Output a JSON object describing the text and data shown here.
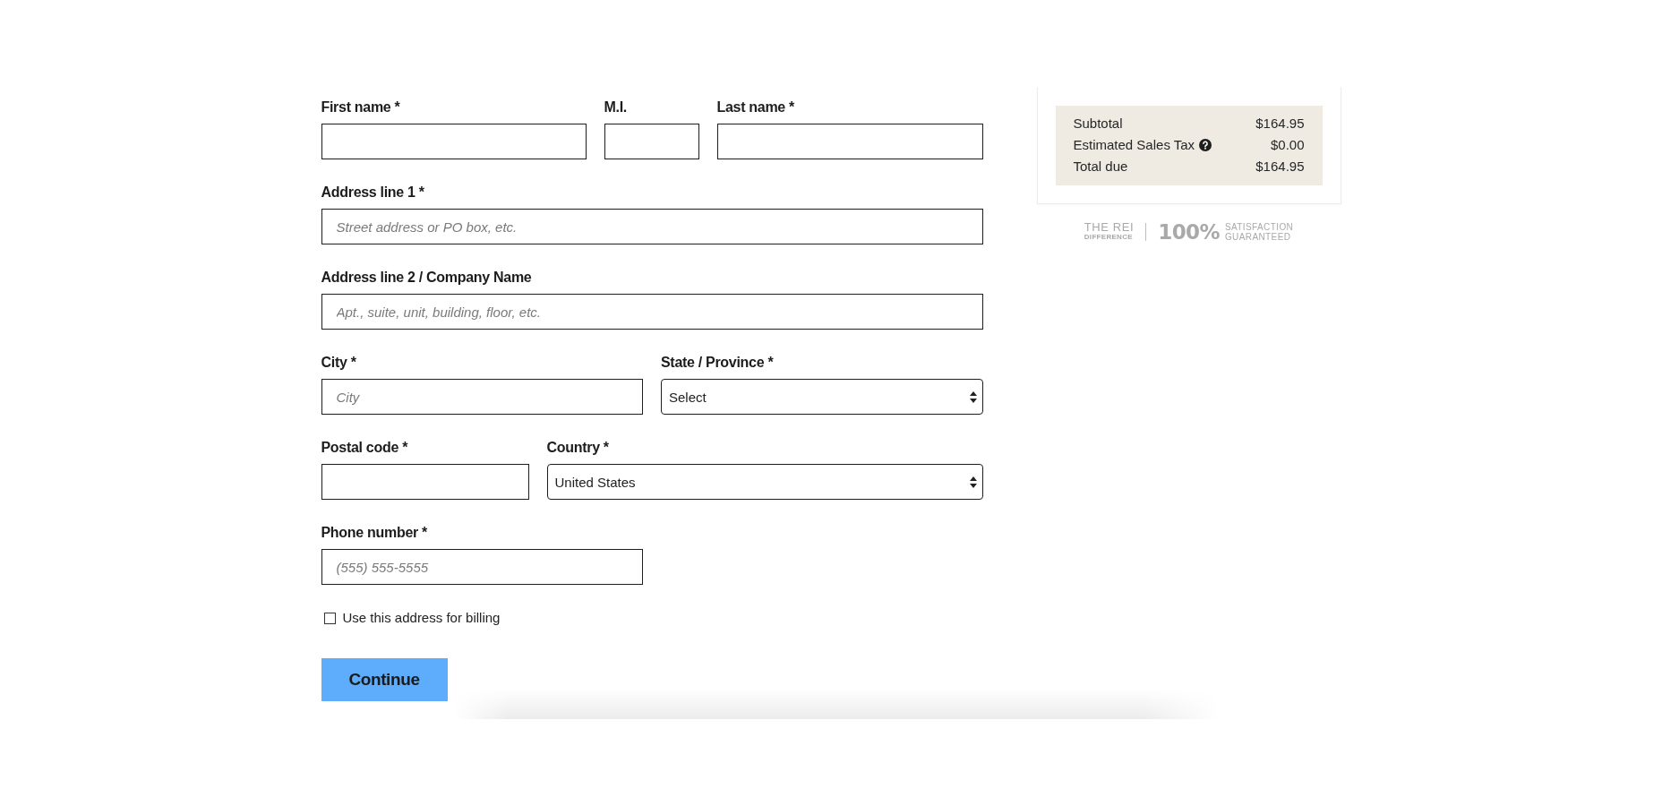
{
  "shipping_form": {
    "rows": [
      {
        "fields": [
          {
            "kind": "input",
            "label": "First name *"
          },
          {
            "kind": "input",
            "label": "M.I."
          },
          {
            "kind": "input",
            "label": "Last name *"
          }
        ]
      },
      {
        "fields": [
          {
            "kind": "input",
            "label": "Address line 1 *",
            "placeholder": "Street address or PO box, etc."
          }
        ]
      },
      {
        "fields": [
          {
            "kind": "input",
            "label": "Address line 2 / Company Name",
            "placeholder": "Apt., suite, unit, building, floor, etc."
          }
        ]
      },
      {
        "fields": [
          {
            "kind": "input",
            "label": "City *",
            "placeholder": "City"
          },
          {
            "kind": "select",
            "label": "State / Province *",
            "value": "Select"
          }
        ]
      },
      {
        "fields": [
          {
            "kind": "input",
            "label": "Postal code *"
          },
          {
            "kind": "select",
            "label": "Country *",
            "value": "United States"
          }
        ]
      },
      {
        "fields": [
          {
            "kind": "input",
            "label": "Phone number *",
            "placeholder": "(555) 555-5555"
          }
        ]
      }
    ],
    "billing_checkbox": {
      "label": "Use this address for billing",
      "checked": false
    },
    "continue_button": "Continue"
  },
  "order_summary": {
    "rows": [
      {
        "label": "Subtotal",
        "help_icon": false,
        "value": "$164.95"
      },
      {
        "label": "Estimated Sales Tax",
        "help_icon": true,
        "value": "$0.00"
      },
      {
        "label": "Total due",
        "help_icon": false,
        "value": "$164.95"
      }
    ]
  },
  "guarantee_logo": {
    "brand": "THE REI",
    "brand_subline": "DIFFERENCE",
    "percent": "100%",
    "claim_line_1": "SATISFACTION",
    "claim_line_2": "GUARANTEED"
  }
}
